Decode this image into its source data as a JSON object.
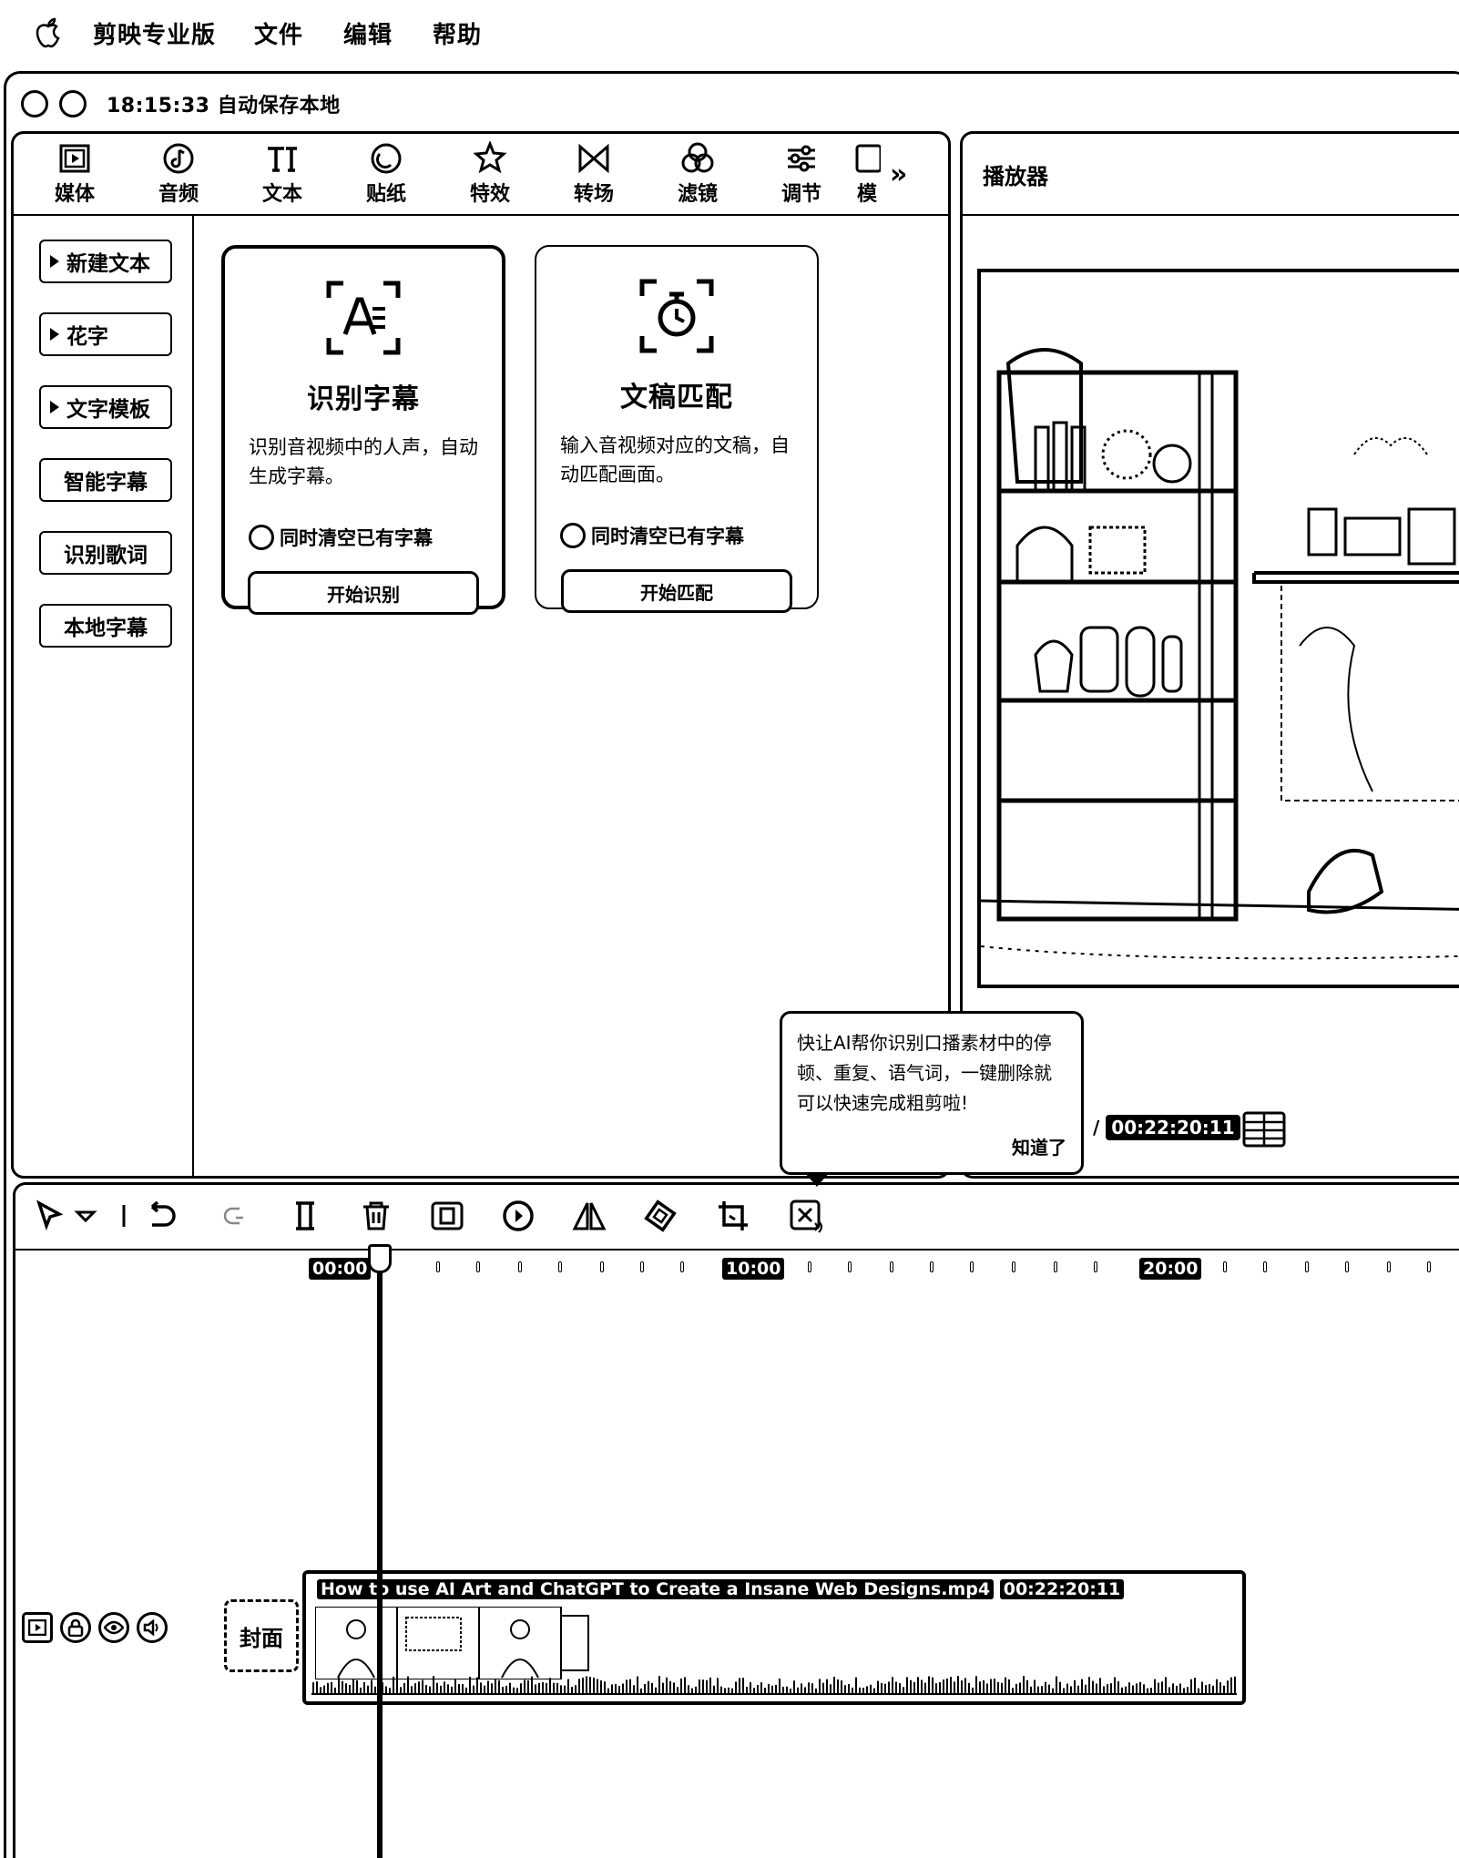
{
  "menubar": {
    "app_name": "剪映专业版",
    "items": [
      "文件",
      "编辑",
      "帮助"
    ]
  },
  "window": {
    "save_status": "18:15:33 自动保存本地"
  },
  "tabs": [
    {
      "label": "媒体",
      "icon": "media-icon"
    },
    {
      "label": "音频",
      "icon": "audio-icon"
    },
    {
      "label": "文本",
      "icon": "text-icon"
    },
    {
      "label": "贴纸",
      "icon": "sticker-icon"
    },
    {
      "label": "特效",
      "icon": "effects-icon"
    },
    {
      "label": "转场",
      "icon": "transition-icon"
    },
    {
      "label": "滤镜",
      "icon": "filter-icon"
    },
    {
      "label": "调节",
      "icon": "adjust-icon"
    },
    {
      "label": "模",
      "icon": "template-icon"
    }
  ],
  "more_tabs": "»",
  "sidebar": {
    "items": [
      {
        "label": "新建文本",
        "arrow": true
      },
      {
        "label": "花字",
        "arrow": true
      },
      {
        "label": "文字模板",
        "arrow": true
      },
      {
        "label": "智能字幕",
        "arrow": false
      },
      {
        "label": "识别歌词",
        "arrow": false
      },
      {
        "label": "本地字幕",
        "arrow": false
      }
    ]
  },
  "cards": [
    {
      "title": "识别字幕",
      "desc": "识别音视频中的人声，自动生成字幕。",
      "checkbox": "同时清空已有字幕",
      "button": "开始识别",
      "icon": "recognize-subtitle-icon",
      "selected": true
    },
    {
      "title": "文稿匹配",
      "desc": "输入音视频对应的文稿，自动匹配画面。",
      "checkbox": "同时清空已有字幕",
      "button": "开始匹配",
      "icon": "script-match-icon",
      "selected": false
    }
  ],
  "player": {
    "title": "播放器",
    "total_time": "00:22:20:11"
  },
  "tooltip": {
    "text": "快让AI帮你识别口播素材中的停顿、重复、语气词，一键删除就可以快速完成粗剪啦!",
    "ok": "知道了"
  },
  "timeline": {
    "ruler_labels": [
      "00:00",
      "10:00",
      "20:00"
    ],
    "cover_label": "封面",
    "clip_name": "How to use AI Art and ChatGPT to Create a Insane Web Designs.mp4",
    "clip_duration": "00:22:20:11"
  }
}
